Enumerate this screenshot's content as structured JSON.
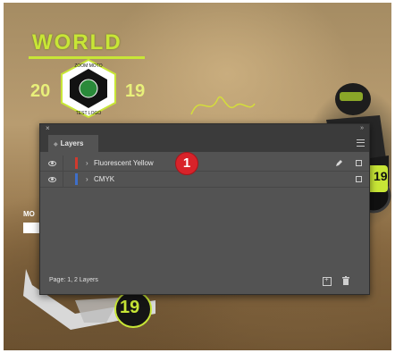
{
  "poster": {
    "title": "WORLD",
    "year_left": "20",
    "year_right": "19",
    "badge_top": "ZOOM MOTO",
    "badge_bottom": "TEST LOGO",
    "moto_text": "MO",
    "shield_number": "19",
    "rider_number": "19"
  },
  "panel": {
    "close_glyph": "×",
    "collapse_glyph": "»",
    "tab_label": "Layers",
    "layers": [
      {
        "name": "Fluorescent Yellow",
        "color": "#d03a2e",
        "visible": true,
        "selected": true
      },
      {
        "name": "CMYK",
        "color": "#3f6fc9",
        "visible": true,
        "selected": false
      }
    ],
    "footer_text": "Page: 1, 2 Layers"
  },
  "callout": {
    "number": "1",
    "color": "#d8232a"
  }
}
